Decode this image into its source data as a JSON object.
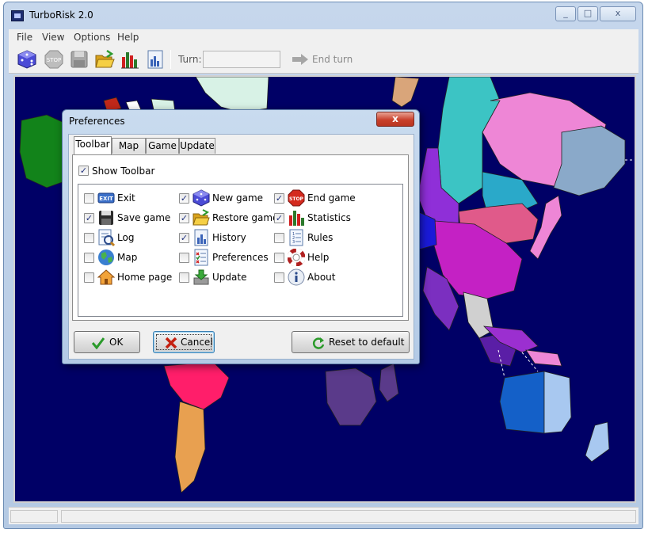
{
  "window": {
    "title": "TurboRisk 2.0"
  },
  "menu": [
    "File",
    "View",
    "Options",
    "Help"
  ],
  "toolbar": {
    "turn_label": "Turn:",
    "turn_value": "",
    "end_turn_label": "End turn"
  },
  "dialog": {
    "title": "Preferences",
    "tabs": [
      "Toolbar",
      "Map",
      "Game",
      "Update"
    ],
    "active_tab": "Toolbar",
    "show_toolbar": {
      "label": "Show Toolbar",
      "checked": true
    },
    "options": [
      {
        "label": "Exit",
        "checked": false,
        "icon": "exit-icon"
      },
      {
        "label": "Save game",
        "checked": true,
        "icon": "floppy-disk-icon"
      },
      {
        "label": "Log",
        "checked": false,
        "icon": "log-icon"
      },
      {
        "label": "Map",
        "checked": false,
        "icon": "globe-icon"
      },
      {
        "label": "Home page",
        "checked": false,
        "icon": "home-icon"
      },
      {
        "label": "New game",
        "checked": true,
        "icon": "dice-icon"
      },
      {
        "label": "Restore game",
        "checked": true,
        "icon": "open-folder-icon"
      },
      {
        "label": "History",
        "checked": true,
        "icon": "history-chart-icon"
      },
      {
        "label": "Preferences",
        "checked": false,
        "icon": "preferences-list-icon"
      },
      {
        "label": "Update",
        "checked": false,
        "icon": "update-icon"
      },
      {
        "label": "End game",
        "checked": true,
        "icon": "stop-sign-icon"
      },
      {
        "label": "Statistics",
        "checked": true,
        "icon": "bar-chart-icon"
      },
      {
        "label": "Rules",
        "checked": false,
        "icon": "rules-icon"
      },
      {
        "label": "Help",
        "checked": false,
        "icon": "lifebuoy-icon"
      },
      {
        "label": "About",
        "checked": false,
        "icon": "info-icon"
      }
    ],
    "buttons": {
      "ok": "OK",
      "cancel": "Cancel",
      "reset": "Reset to default"
    },
    "close_glyph": "x"
  },
  "window_controls": {
    "minimize": "_",
    "maximize": "□",
    "close": "x"
  },
  "colors": {
    "ocean": "#000066",
    "dialog_frame": "#b3cae6",
    "close_red": "#c9412c"
  }
}
